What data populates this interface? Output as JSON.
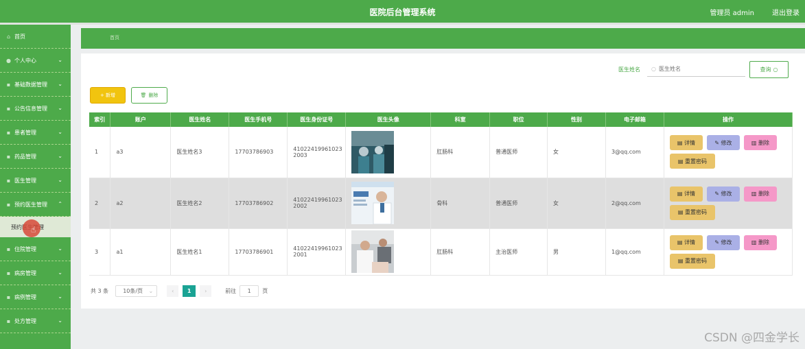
{
  "header": {
    "title": "医院后台管理系统",
    "admin": "管理员 admin",
    "logout": "退出登录"
  },
  "sidebar": {
    "items": [
      {
        "label": "首页",
        "chevron": ""
      },
      {
        "label": "个人中心",
        "chevron": "⌄"
      },
      {
        "label": "基础数据管理",
        "chevron": "⌄"
      },
      {
        "label": "公告信息管理",
        "chevron": "⌄"
      },
      {
        "label": "患者管理",
        "chevron": "⌄"
      },
      {
        "label": "药品管理",
        "chevron": "⌄"
      },
      {
        "label": "医生管理",
        "chevron": "⌄"
      },
      {
        "label": "预约医生管理",
        "chevron": "⌃"
      }
    ],
    "sub_item": "预约医生管理",
    "items_after": [
      {
        "label": "住院管理",
        "chevron": "⌄"
      },
      {
        "label": "病房管理",
        "chevron": "⌄"
      },
      {
        "label": "病例管理",
        "chevron": "⌄"
      },
      {
        "label": "处方管理",
        "chevron": "⌄"
      }
    ]
  },
  "breadcrumb": "首页",
  "search": {
    "label": "医生姓名",
    "placeholder": "医生姓名",
    "button": "查询"
  },
  "actions": {
    "add": "+ 新增",
    "delete": "删除"
  },
  "table": {
    "columns": [
      "索引",
      "账户",
      "医生姓名",
      "医生手机号",
      "医生身份证号",
      "医生头像",
      "科室",
      "职位",
      "性别",
      "电子邮箱",
      "操作"
    ],
    "rows": [
      {
        "index": "1",
        "account": "a3",
        "name": "医生姓名3",
        "phone": "17703786903",
        "id_card": "41022419961023 2003",
        "dept": "肛肠科",
        "title": "普通医师",
        "gender": "女",
        "email": "3@qq.com"
      },
      {
        "index": "2",
        "account": "a2",
        "name": "医生姓名2",
        "phone": "17703786902",
        "id_card": "41022419961023 2002",
        "dept": "骨科",
        "title": "普通医师",
        "gender": "女",
        "email": "2@qq.com"
      },
      {
        "index": "3",
        "account": "a1",
        "name": "医生姓名1",
        "phone": "17703786901",
        "id_card": "41022419961023 2001",
        "dept": "肛肠科",
        "title": "主治医师",
        "gender": "男",
        "email": "1@qq.com"
      }
    ],
    "ops": {
      "detail": "详情",
      "edit": "修改",
      "remove": "删除",
      "reset": "重置密码"
    }
  },
  "pager": {
    "total": "共 3 条",
    "page_size": "10条/页",
    "current": "1",
    "goto": "前往",
    "goto_value": "1",
    "page_suffix": "页"
  },
  "watermark": "CSDN @四金学长"
}
